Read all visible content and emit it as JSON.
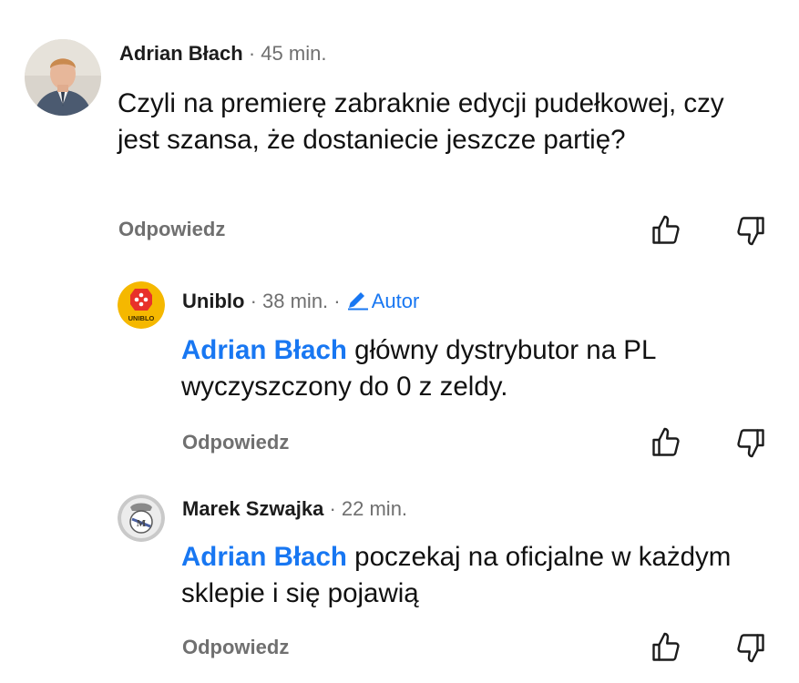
{
  "comments": [
    {
      "author": "Adrian Błach",
      "separator": "·",
      "time": "45 min.",
      "text": "Czyli na premierę zabraknie edycji pudełkowej, czy jest szansa, że dostaniecie jeszcze partię?",
      "reply_label": "Odpowiedz"
    },
    {
      "author": "Uniblo",
      "separator": "·",
      "time": "38 min.",
      "badge": "Autor",
      "mention": "Adrian Błach",
      "text": " główny dystrybutor na PL wyczyszczony do 0 z zeldy.",
      "reply_label": "Odpowiedz",
      "avatar_text": "UNIBLO"
    },
    {
      "author": "Marek Szwajka",
      "separator": "·",
      "time": "22 min.",
      "mention": "Adrian Błach",
      "text": " poczekaj na oficjalne w każdym sklepie i się pojawią",
      "reply_label": "Odpowiedz"
    }
  ],
  "icons": {
    "like": "thumbs-up-icon",
    "dislike": "thumbs-down-icon",
    "badge": "pencil-icon"
  },
  "colors": {
    "accent": "#1877f2",
    "muted": "#707070",
    "uniblo_yellow": "#f5b800",
    "uniblo_red": "#e8312a"
  }
}
